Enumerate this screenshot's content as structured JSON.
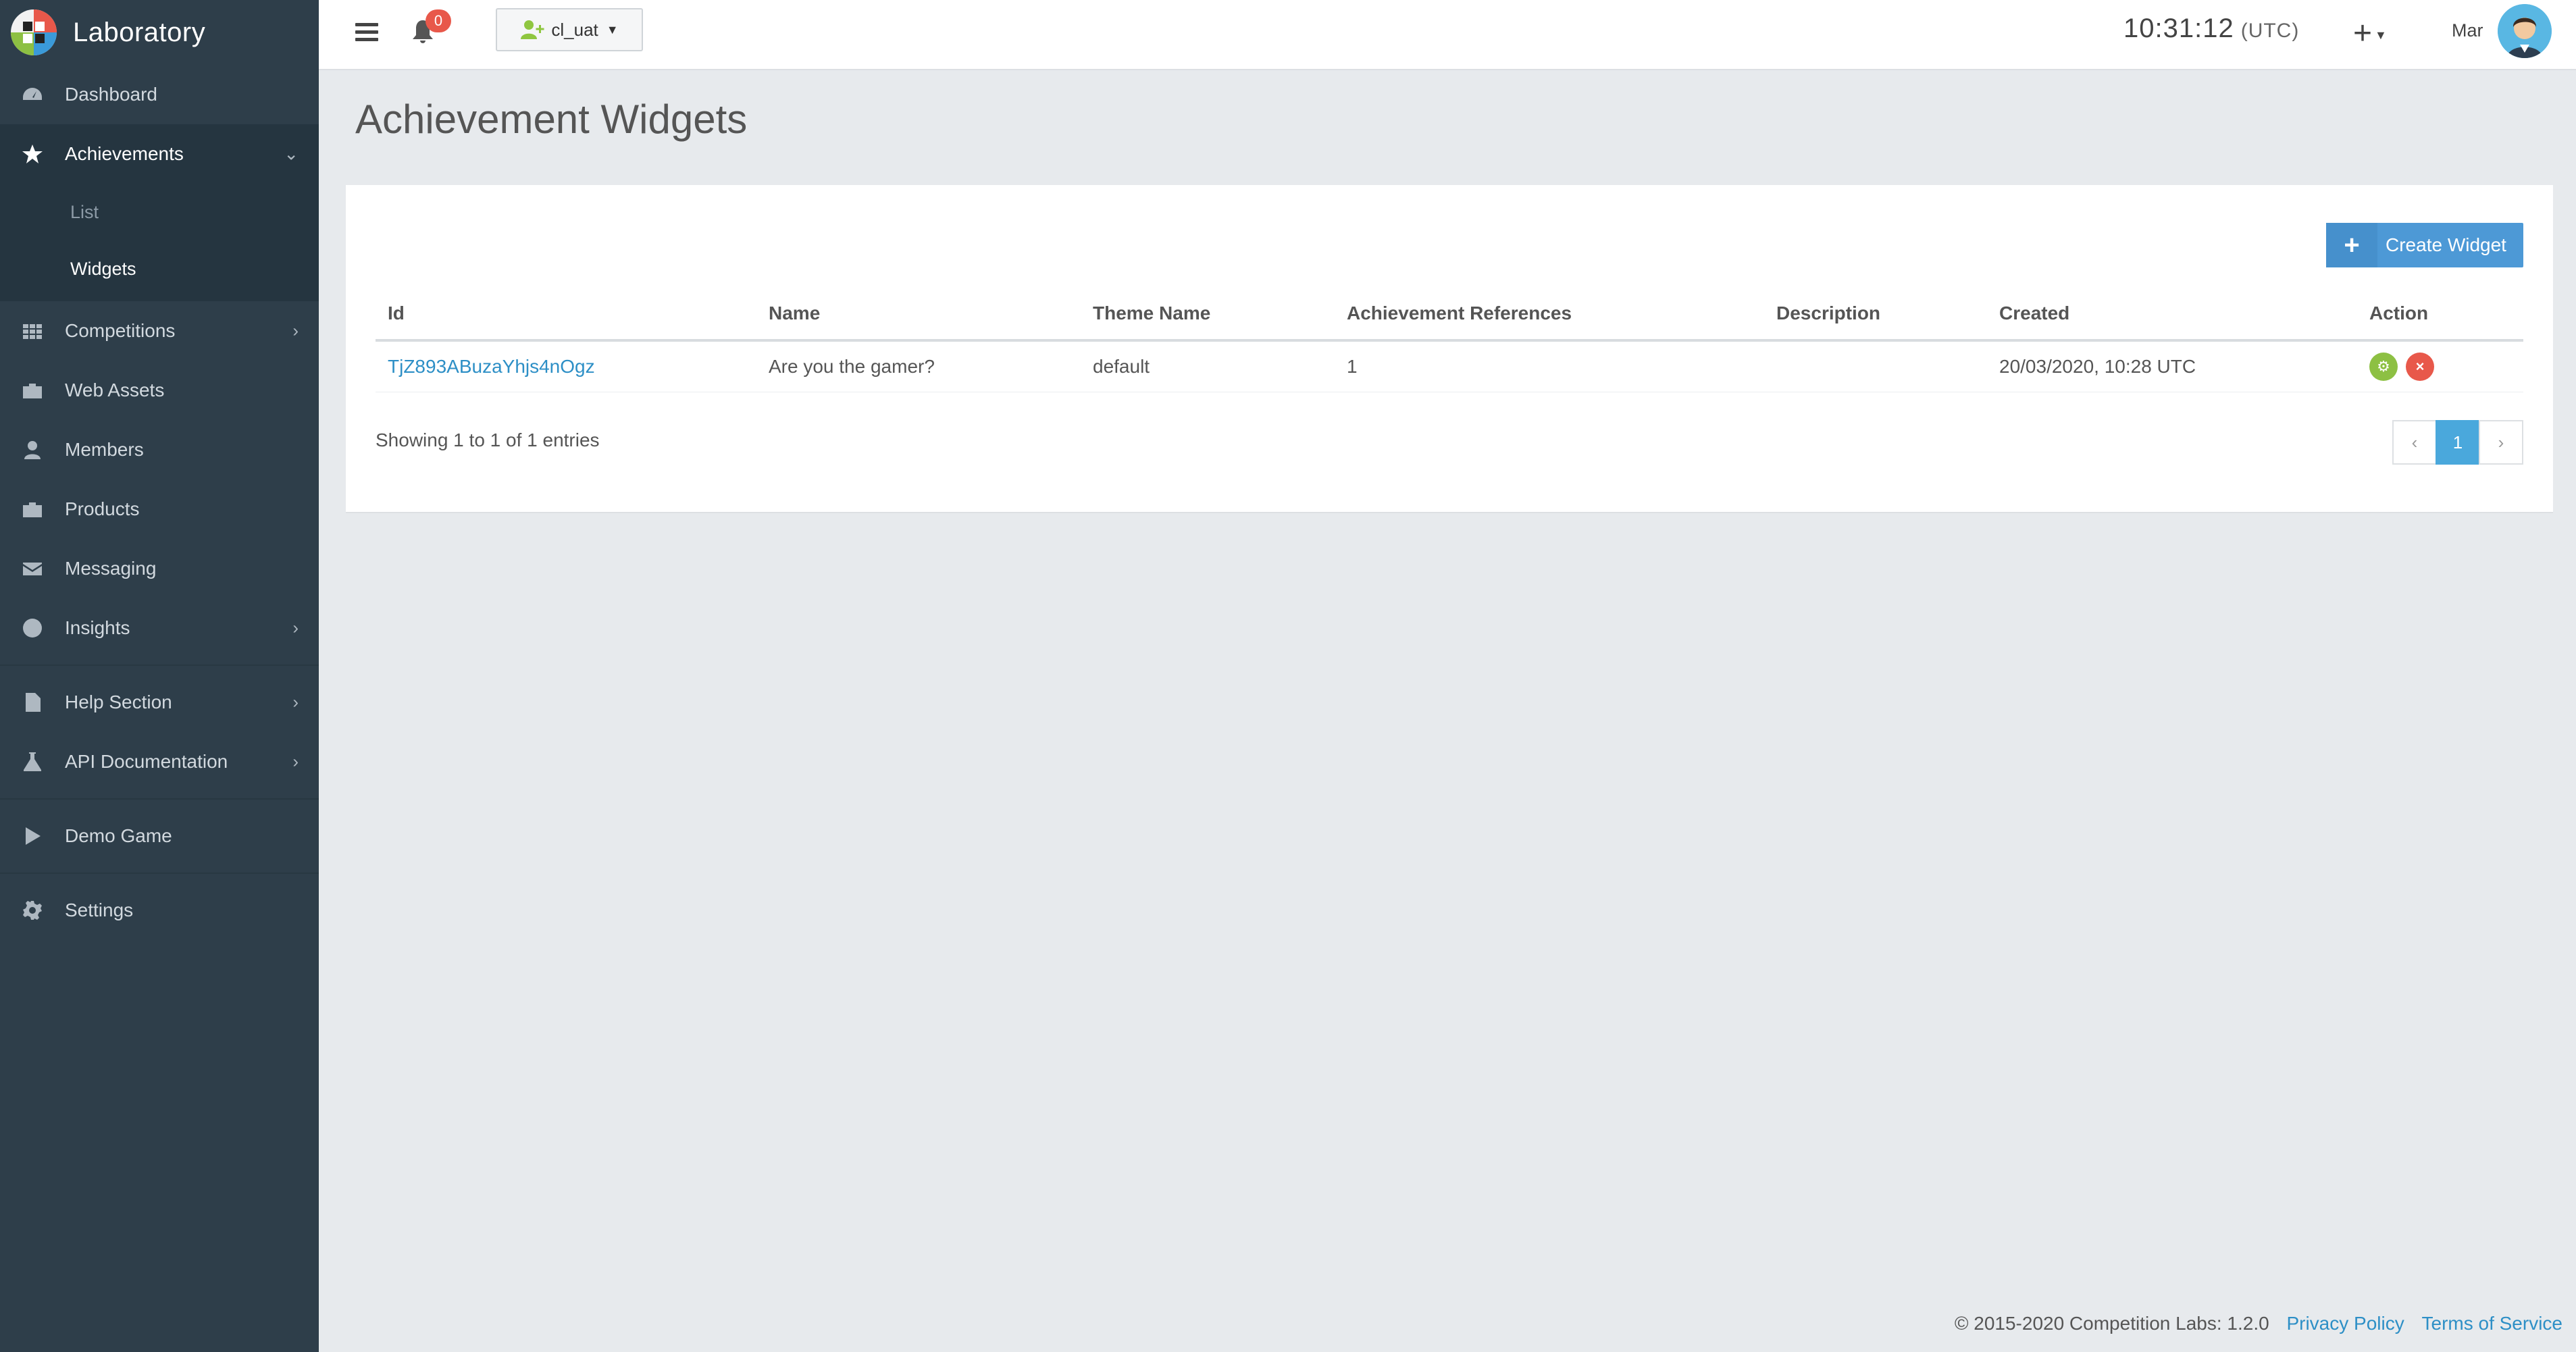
{
  "brand": {
    "name": "Laboratory"
  },
  "sidebar": {
    "items": [
      {
        "label": "Dashboard"
      },
      {
        "label": "Achievements"
      },
      {
        "label": "Competitions"
      },
      {
        "label": "Web Assets"
      },
      {
        "label": "Members"
      },
      {
        "label": "Products"
      },
      {
        "label": "Messaging"
      },
      {
        "label": "Insights"
      },
      {
        "label": "Help Section"
      },
      {
        "label": "API Documentation"
      },
      {
        "label": "Demo Game"
      },
      {
        "label": "Settings"
      }
    ],
    "achievements_sub": [
      {
        "label": "List"
      },
      {
        "label": "Widgets"
      }
    ]
  },
  "topbar": {
    "notifications": "0",
    "account": "cl_uat",
    "time": "10:31:12",
    "timezone": "(UTC)",
    "plus": "+",
    "user": "Mar"
  },
  "page": {
    "title": "Achievement Widgets",
    "create_button": "Create Widget"
  },
  "table": {
    "headers": [
      "Id",
      "Name",
      "Theme Name",
      "Achievement References",
      "Description",
      "Created",
      "Action"
    ],
    "rows": [
      {
        "id": "TjZ893ABuzaYhjs4nOgz",
        "name": "Are you the gamer?",
        "theme": "default",
        "refs": "1",
        "description": "",
        "created": "20/03/2020, 10:28 UTC"
      }
    ],
    "entries": "Showing 1 to 1 of 1 entries",
    "pager": {
      "prev": "‹",
      "current": "1",
      "next": "›"
    }
  },
  "footer": {
    "copyright": "© 2015-2020 Competition Labs: 1.2.0",
    "privacy": "Privacy Policy",
    "terms": "Terms of Service"
  },
  "colors": {
    "sidebar": "#2e3e4a",
    "primary": "#4d99d6",
    "link": "#2d8fc6",
    "success": "#8dc043",
    "danger": "#e8584a"
  }
}
